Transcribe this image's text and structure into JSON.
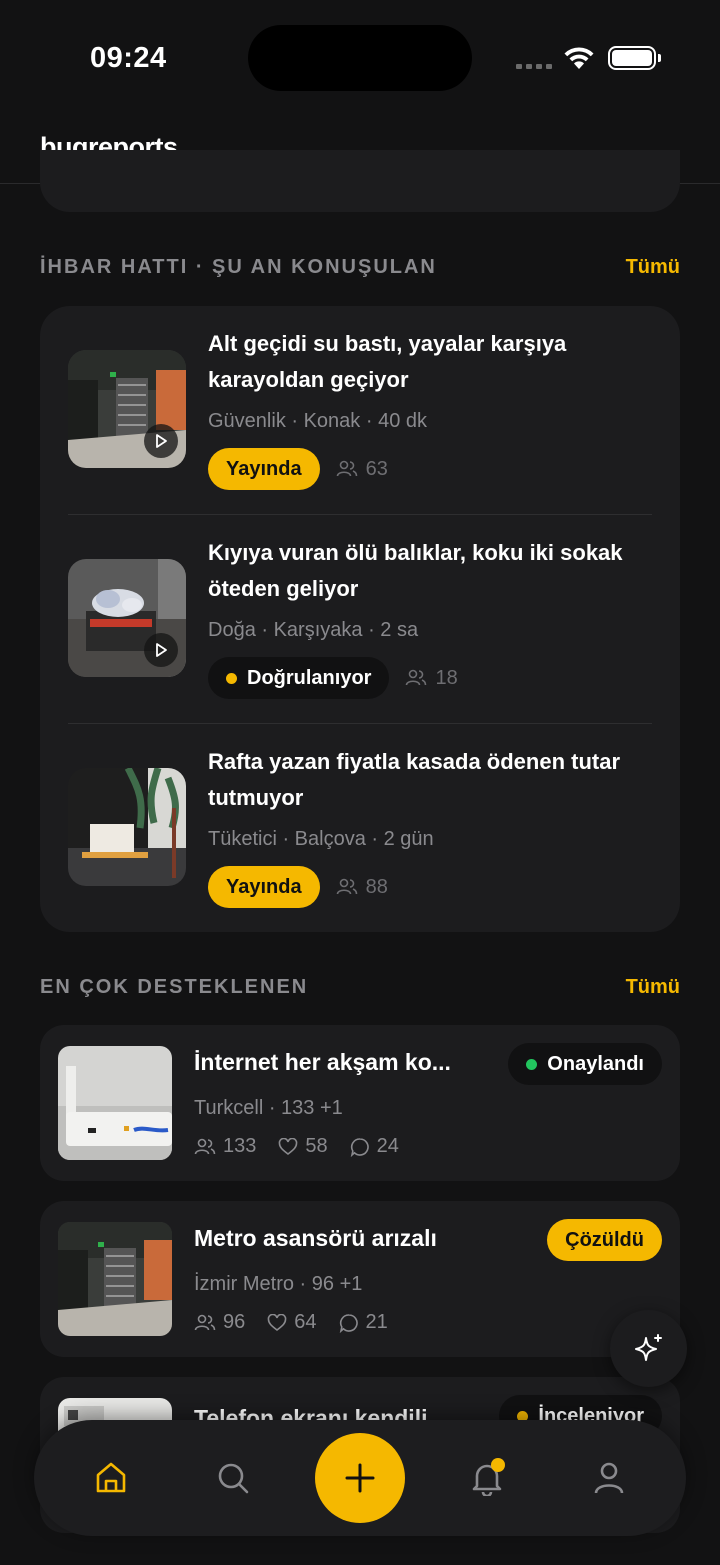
{
  "status_bar": {
    "time": "09:24"
  },
  "app": {
    "logo": "bugreports",
    "logo_dot": "."
  },
  "hotline": {
    "title": "İHBAR HATTI · ŞU AN KONUŞULAN",
    "link": "Tümü",
    "items": [
      {
        "title": "Alt geçidi su bastı, yayalar karşıya karayoldan geçiyor",
        "meta": "Güvenlik · Konak · 40 dk",
        "status": "Yayında",
        "status_style": "yellow",
        "count": "63",
        "video": true
      },
      {
        "title": "Kıyıya vuran ölü balıklar, koku iki sokak öteden geliyor",
        "meta": "Doğa · Karşıyaka · 2 sa",
        "status": "Doğrulanıyor",
        "status_style": "dark",
        "count": "18",
        "video": true
      },
      {
        "title": "Rafta yazan fiyatla kasada ödenen tutar tutmuyor",
        "meta": "Tüketici · Balçova · 2 gün",
        "status": "Yayında",
        "status_style": "yellow",
        "count": "88",
        "video": false
      }
    ]
  },
  "supported": {
    "title": "EN ÇOK DESTEKLENEN",
    "link": "Tümü",
    "items": [
      {
        "title": "İnternet her akşam ko...",
        "meta": "Turkcell · 133 +1",
        "supporters": "133",
        "likes": "58",
        "comments": "24",
        "status": "Onaylandı",
        "status_color": "#22c55e"
      },
      {
        "title": "Metro asansörü arızalı",
        "meta": "İzmir Metro · 96 +1",
        "supporters": "96",
        "likes": "64",
        "comments": "21",
        "status": "Çözüldü",
        "status_color": "#f5b800"
      },
      {
        "title": "Telefon ekranı kendili",
        "status": "İnceleniyor",
        "status_color": "#f5b800"
      }
    ]
  },
  "colors": {
    "accent": "#f5b800",
    "background": "#121213",
    "card": "#1c1c1e",
    "success": "#22c55e"
  },
  "tabs": [
    {
      "icon": "home-icon",
      "active": true
    },
    {
      "icon": "search-icon",
      "active": false
    },
    {
      "icon": "plus-icon",
      "active": false
    },
    {
      "icon": "bell-icon",
      "active": false,
      "has_notification": true
    },
    {
      "icon": "profile-icon",
      "active": false
    }
  ]
}
